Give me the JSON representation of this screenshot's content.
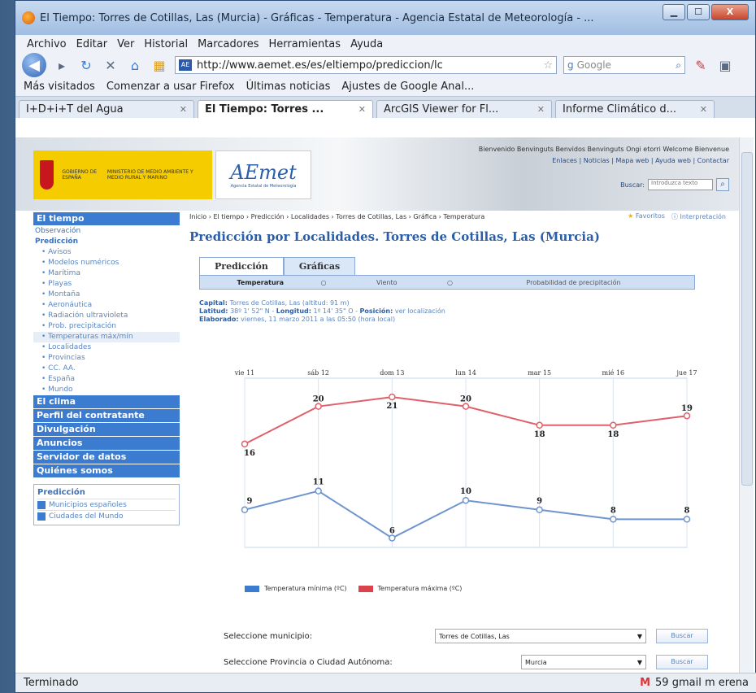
{
  "window": {
    "title": "El Tiempo: Torres de Cotillas, Las (Murcia) - Gráficas - Temperatura - Agencia Estatal de Meteorología - ...",
    "controls": [
      "▁",
      "☐",
      "X"
    ]
  },
  "menu": [
    "Archivo",
    "Editar",
    "Ver",
    "Historial",
    "Marcadores",
    "Herramientas",
    "Ayuda"
  ],
  "navbar": {
    "url": "http://www.aemet.es/es/eltiempo/prediccion/lc",
    "search_placeholder": "Google"
  },
  "bookmarks": [
    "Más visitados",
    "Comenzar a usar Firefox",
    "Últimas noticias",
    "Ajustes de Google Anal..."
  ],
  "tabs": [
    {
      "label": "I+D+i+T del Agua",
      "active": false
    },
    {
      "label": "El Tiempo: Torres ...",
      "active": true
    },
    {
      "label": "ArcGIS Viewer for Fl...",
      "active": false
    },
    {
      "label": "Informe Climático d...",
      "active": false
    }
  ],
  "page": {
    "header": {
      "gob_text": "GOBIERNO DE ESPAÑA",
      "ministry_text": "MINISTERIO DE MEDIO AMBIENTE Y MEDIO RURAL Y MARINO",
      "logo": "AEmet",
      "logo_sub": "Agencia Estatal de Meteorología",
      "welcome": "Bienvenido Benvinguts Benvidos Benvinguts Ongi etorri Welcome Bienvenue",
      "links": "Enlaces | Noticias | Mapa web | Ayuda web | Contactar",
      "search_label": "Buscar:",
      "search_placeholder": "Introduzca texto"
    },
    "sidebar": {
      "sections": [
        {
          "title": "El tiempo"
        },
        {
          "title": "El clima"
        },
        {
          "title": "Perfil del contratante"
        },
        {
          "title": "Divulgación"
        },
        {
          "title": "Anuncios"
        },
        {
          "title": "Servidor de datos"
        },
        {
          "title": "Quiénes somos"
        }
      ],
      "el_tiempo_items": [
        "Observación",
        "Predicción"
      ],
      "prediccion_items": [
        "Avisos",
        "Modelos numéricos",
        "Marítima",
        "Playas",
        "Montaña",
        "Aeronáutica",
        "Radiación ultravioleta",
        "Prob. precipitación",
        "Temperaturas máx/mín",
        "Localidades",
        "Provincias",
        "CC. AA.",
        "España",
        "Mundo"
      ],
      "panel_title": "Predicción",
      "panel_links": [
        "Municipios españoles",
        "Ciudades del Mundo"
      ]
    },
    "main": {
      "breadcrumb": "Inicio › El tiempo › Predicción › Localidades › Torres de Cotillas, Las › Gráfica › Temperatura",
      "fav": "Favoritos",
      "interp": "Interpretación",
      "title": "Predicción por Localidades. Torres de Cotillas, Las (Murcia)",
      "tabs": [
        "Predicción",
        "Gráficas"
      ],
      "subtabs": [
        "Temperatura",
        "Viento",
        "Probabilidad de precipitación"
      ],
      "meta": {
        "capital_label": "Capital:",
        "capital": "Torres de Cotillas, Las (altitud: 91 m)",
        "lat_label": "Latitud:",
        "lat": "38º 1' 52\" N",
        "lon_label": "Longitud:",
        "lon": "1º 14' 35\" O",
        "pos_label": "Posición:",
        "pos": "ver localización",
        "elab_label": "Elaborado:",
        "elab": "viernes, 11 marzo 2011 a las 05:50 (hora local)"
      },
      "form": {
        "row1_label": "Seleccione municipio:",
        "row1_value": "Torres de Cotillas, Las",
        "row2_label": "Seleccione Provincia o Ciudad Autónoma:",
        "row2_value": "Murcia",
        "button": "Buscar"
      }
    }
  },
  "status": {
    "left": "Terminado",
    "right": "59 gmail m erena"
  },
  "colors": {
    "min": "#6f95cf",
    "max": "#e0606a",
    "accent": "#3b7bd0"
  },
  "chart_data": {
    "type": "line",
    "categories": [
      "vie 11",
      "sáb 12",
      "dom 13",
      "lun 14",
      "mar 15",
      "mié 16",
      "jue 17"
    ],
    "series": [
      {
        "name": "Temperatura mínima (ºC)",
        "values": [
          9,
          11,
          6,
          10,
          9,
          8,
          8
        ]
      },
      {
        "name": "Temperatura máxima (ºC)",
        "values": [
          16,
          20,
          21,
          20,
          18,
          18,
          19
        ]
      }
    ],
    "ylim": [
      5,
      23
    ],
    "grid": true,
    "legend": "bottom"
  }
}
